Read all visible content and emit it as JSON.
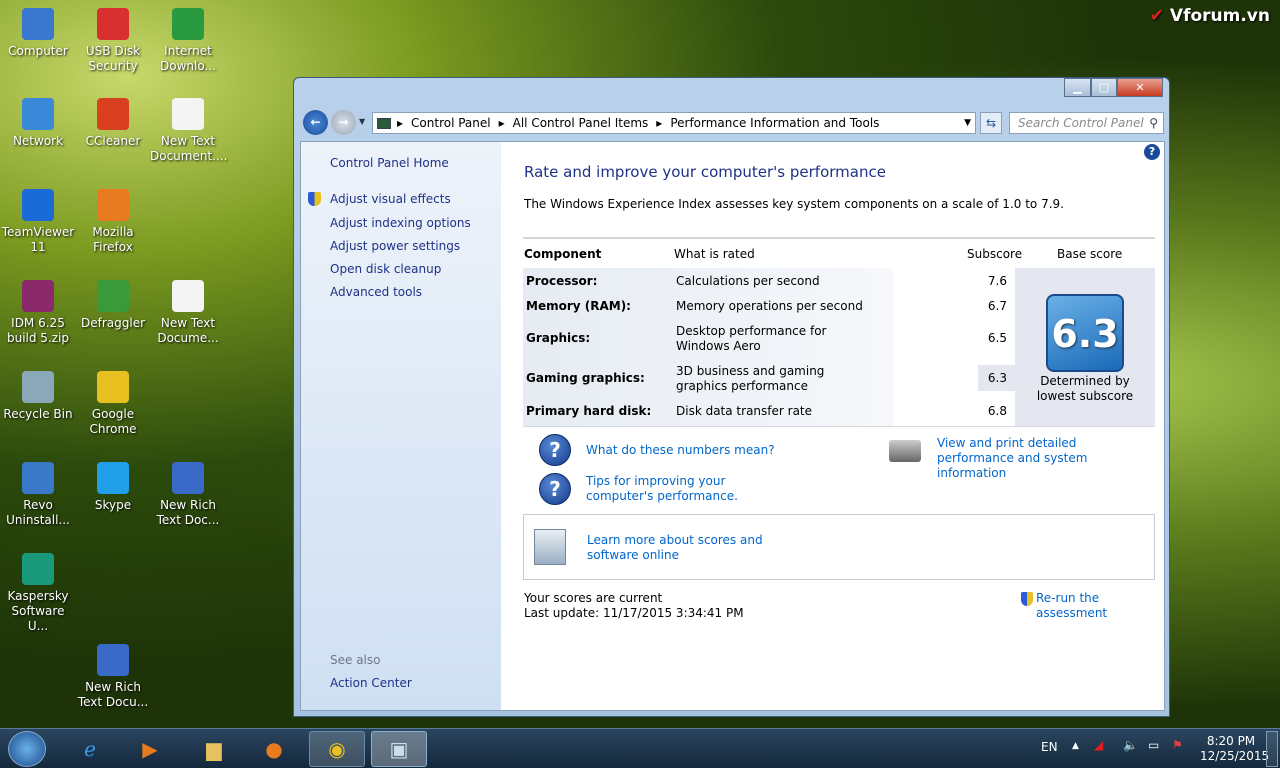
{
  "watermark": "Vforum.vn",
  "desktop_icons": [
    {
      "label": "Computer",
      "color": "#3a78d0"
    },
    {
      "label": "USB Disk Security",
      "color": "#d83030"
    },
    {
      "label": "Internet Downlo...",
      "color": "#2a9a40"
    },
    {
      "label": "Network",
      "color": "#3a88d8"
    },
    {
      "label": "CCleaner",
      "color": "#d84020"
    },
    {
      "label": "New Text Document....",
      "color": "#f4f4f4"
    },
    {
      "label": "TeamViewer 11",
      "color": "#1a6ad8"
    },
    {
      "label": "Mozilla Firefox",
      "color": "#e87a20"
    },
    {
      "label": "IDM 6.25 build 5.zip",
      "color": "#8a2a6a"
    },
    {
      "label": "Defraggler",
      "color": "#3a9a3a"
    },
    {
      "label": "New Text Docume...",
      "color": "#f4f4f4"
    },
    {
      "label": "Recycle Bin",
      "color": "#8aa8b8"
    },
    {
      "label": "Google Chrome",
      "color": "#e8c020"
    },
    {
      "label": "Revo Uninstall...",
      "color": "#3a78c8"
    },
    {
      "label": "Skype",
      "color": "#20a0e8"
    },
    {
      "label": "New Rich Text Doc...",
      "color": "#3a6ac8"
    },
    {
      "label": "Kaspersky Software U...",
      "color": "#1a9a7a"
    },
    {
      "label": "New Rich Text Docu...",
      "color": "#3a6ac8"
    }
  ],
  "window": {
    "breadcrumb": [
      "Control Panel",
      "All Control Panel Items",
      "Performance Information and Tools"
    ],
    "search_placeholder": "Search Control Panel",
    "sidebar": {
      "home": "Control Panel Home",
      "items": [
        "Adjust visual effects",
        "Adjust indexing options",
        "Adjust power settings",
        "Open disk cleanup",
        "Advanced tools"
      ],
      "see_also": "See also",
      "see_also_items": [
        "Action Center"
      ]
    },
    "main": {
      "title": "Rate and improve your computer's performance",
      "intro": "The Windows Experience Index assesses key system components on a scale of 1.0 to 7.9.",
      "headers": [
        "Component",
        "What is rated",
        "Subscore",
        "Base score"
      ],
      "rows": [
        {
          "component": "Processor:",
          "rated": "Calculations per second",
          "subscore": "7.6"
        },
        {
          "component": "Memory (RAM):",
          "rated": "Memory operations per second",
          "subscore": "6.7"
        },
        {
          "component": "Graphics:",
          "rated": "Desktop performance for Windows Aero",
          "subscore": "6.5"
        },
        {
          "component": "Gaming graphics:",
          "rated": "3D business and gaming graphics performance",
          "subscore": "6.3"
        },
        {
          "component": "Primary hard disk:",
          "rated": "Disk data transfer rate",
          "subscore": "6.8"
        }
      ],
      "base_score": "6.3",
      "base_note": "Determined by lowest subscore",
      "link_numbers": "What do these numbers mean?",
      "link_tips": "Tips for improving your computer's performance.",
      "link_print": "View and print detailed performance and system information",
      "link_learn": "Learn more about scores and software online",
      "status": "Your scores are current",
      "last_update": "Last update: 11/17/2015 3:34:41 PM",
      "rerun": "Re-run the assessment"
    }
  },
  "tray": {
    "lang": "EN",
    "time": "8:20 PM",
    "date": "12/25/2015"
  }
}
